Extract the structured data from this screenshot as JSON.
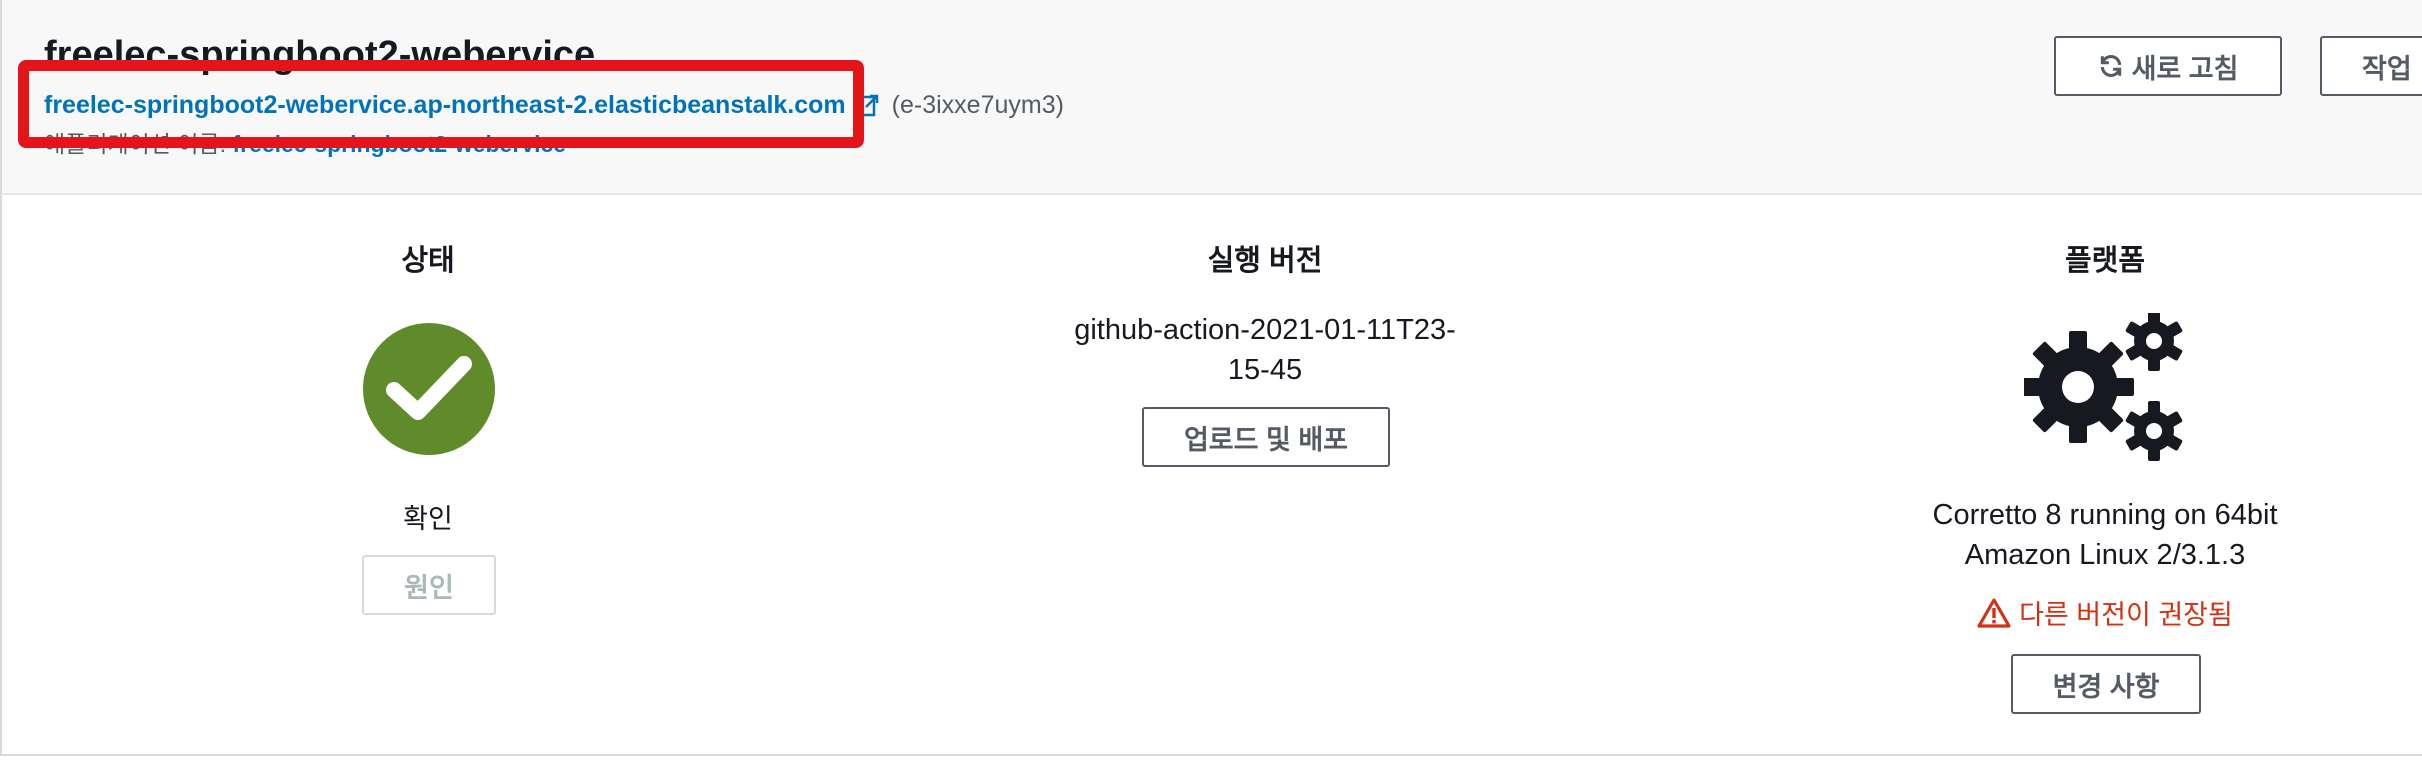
{
  "header": {
    "env_title": "freelec-springboot2-webervice",
    "env_url": "freelec-springboot2-webervice.ap-northeast-2.elasticbeanstalk.com",
    "env_id": "(e-3ixxe7uym3)",
    "app_label": "애플리케이션 이름: ",
    "app_name": "freelec-springboot2-webervice",
    "refresh_label": "새로 고침",
    "actions_label": "작업"
  },
  "status": {
    "title": "상태",
    "value": "확인",
    "cause_label": "원인",
    "icon": "check-circle-icon",
    "color": "#5f8b2b"
  },
  "version": {
    "title": "실행 버전",
    "value_line1": "github-action-2021-01-11T23-",
    "value_line2": "15-45",
    "upload_label": "업로드 및 배포"
  },
  "platform": {
    "title": "플랫폼",
    "icon": "gears-icon",
    "value_line1": "Corretto 8 running on 64bit",
    "value_line2": "Amazon Linux 2/3.1.3",
    "warning": "다른 버전이 권장됨",
    "warning_color": "#d13212",
    "change_label": "변경 사항"
  },
  "annotation": {
    "highlight_color": "#e4141b"
  }
}
